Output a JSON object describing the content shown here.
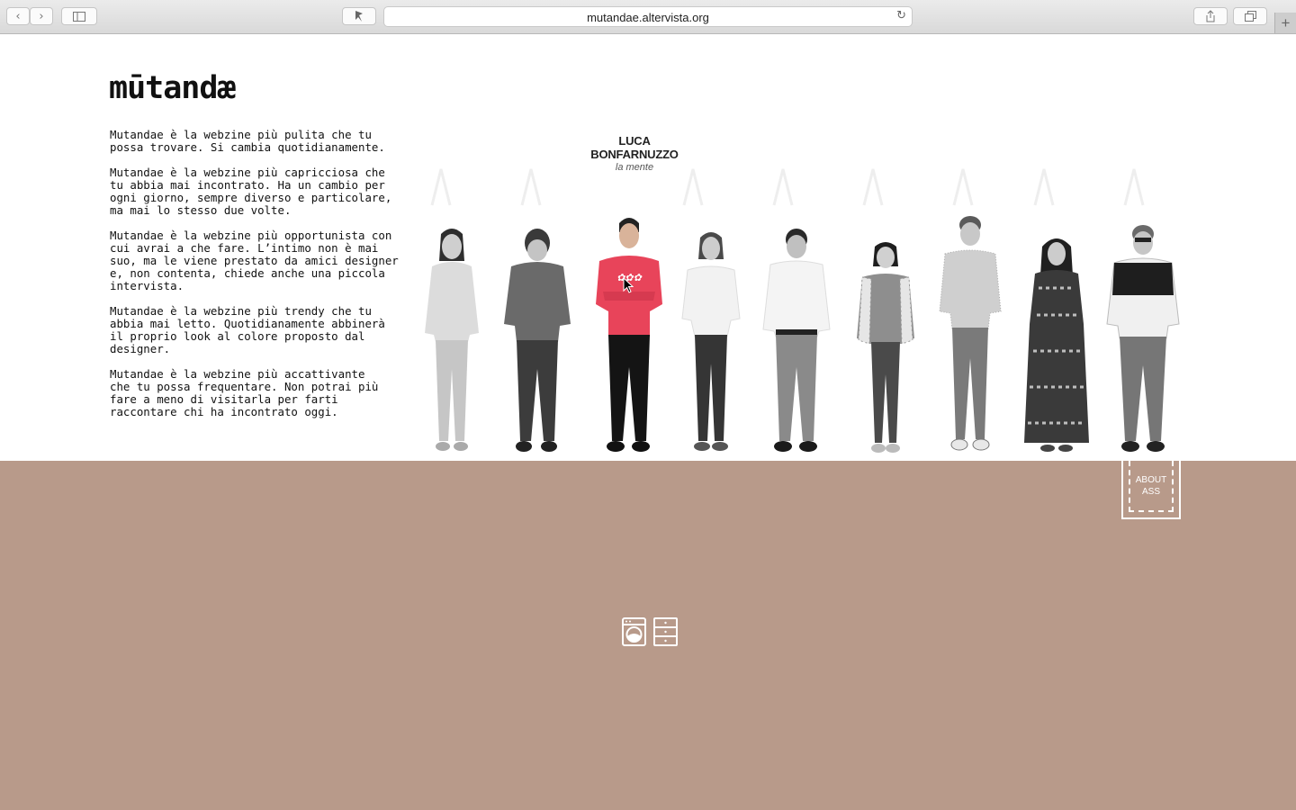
{
  "browser": {
    "url": "mutandae.altervista.org",
    "new_tab_symbol": "+"
  },
  "site": {
    "logo": "mūtandæ",
    "paragraphs": [
      "Mutandae è la webzine più pulita che tu\npossa trovare. Si cambia quotidianamente.",
      "Mutandae è la webzine più capricciosa che\ntu abbia mai incontrato. Ha un cambio per\nogni giorno, sempre diverso e particolare,\nma mai lo stesso due volte.",
      "Mutandae è la webzine più opportunista con\ncui avrai a che fare. L’intimo non è mai\nsuo, ma le viene prestato da amici designer\ne, non contenta, chiede anche una piccola\nintervista.",
      "Mutandae è la webzine più trendy che tu\nabbia mai letto. Quotidianamente abbinerà\nil proprio look al colore proposto dal\ndesigner.",
      "Mutandae è la webzine più accattivante\nche tu possa frequentare. Non potrai più\nfare a meno di visitarla per farti\nraccontare chi ha incontrato oggi."
    ],
    "team_caption": {
      "name_line1": "LUCA",
      "name_line2": "BONFARNUZZO",
      "role": "la mente"
    },
    "about_button": "ABOUT\nASS",
    "colors": {
      "background_brown": "#b89a8a",
      "highlight_red": "#e8445a"
    }
  }
}
